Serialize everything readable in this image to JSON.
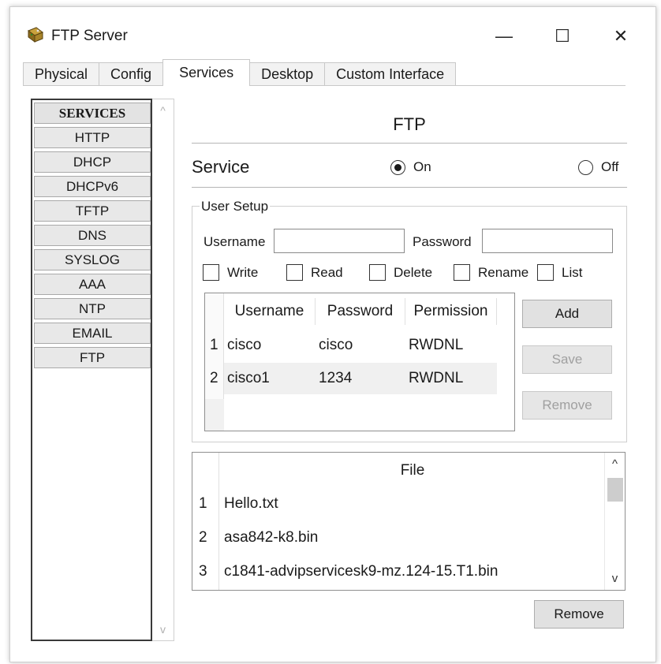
{
  "window": {
    "title": "FTP Server",
    "controls": {
      "minimize": "—",
      "maximize": "☐",
      "close": "✕"
    }
  },
  "tabs": [
    {
      "label": "Physical",
      "active": false
    },
    {
      "label": "Config",
      "active": false
    },
    {
      "label": "Services",
      "active": true
    },
    {
      "label": "Desktop",
      "active": false
    },
    {
      "label": "Custom Interface",
      "active": false
    }
  ],
  "sidebar": {
    "header": "SERVICES",
    "items": [
      "HTTP",
      "DHCP",
      "DHCPv6",
      "TFTP",
      "DNS",
      "SYSLOG",
      "AAA",
      "NTP",
      "EMAIL",
      "FTP"
    ],
    "scroll_up": "^",
    "scroll_down": "v"
  },
  "main": {
    "title": "FTP",
    "service_label": "Service",
    "service_on_label": "On",
    "service_off_label": "Off",
    "service_state": "On"
  },
  "user_setup": {
    "legend": "User Setup",
    "username_label": "Username",
    "username_value": "",
    "password_label": "Password",
    "password_value": "",
    "permissions": [
      {
        "label": "Write",
        "checked": false
      },
      {
        "label": "Read",
        "checked": false
      },
      {
        "label": "Delete",
        "checked": false
      },
      {
        "label": "Rename",
        "checked": false
      },
      {
        "label": "List",
        "checked": false
      }
    ],
    "table": {
      "columns": [
        "Username",
        "Password",
        "Permission"
      ],
      "rows": [
        {
          "index": "1",
          "username": "cisco",
          "password": "cisco",
          "permission": "RWDNL"
        },
        {
          "index": "2",
          "username": "cisco1",
          "password": "1234",
          "permission": "RWDNL"
        }
      ]
    },
    "buttons": {
      "add": "Add",
      "save": "Save",
      "remove": "Remove"
    }
  },
  "files": {
    "column": "File",
    "rows": [
      {
        "index": "1",
        "name": "Hello.txt"
      },
      {
        "index": "2",
        "name": "asa842-k8.bin"
      },
      {
        "index": "3",
        "name": "c1841-advipservicesk9-mz.124-15.T1.bin"
      }
    ],
    "scroll_up": "^",
    "scroll_down": "v",
    "remove_button": "Remove"
  },
  "colors": {
    "window_bg": "#ffffff",
    "tab_bg": "#f2f2f2",
    "button_bg": "#e1e1e1",
    "selected_row": "#f0f0f0"
  }
}
